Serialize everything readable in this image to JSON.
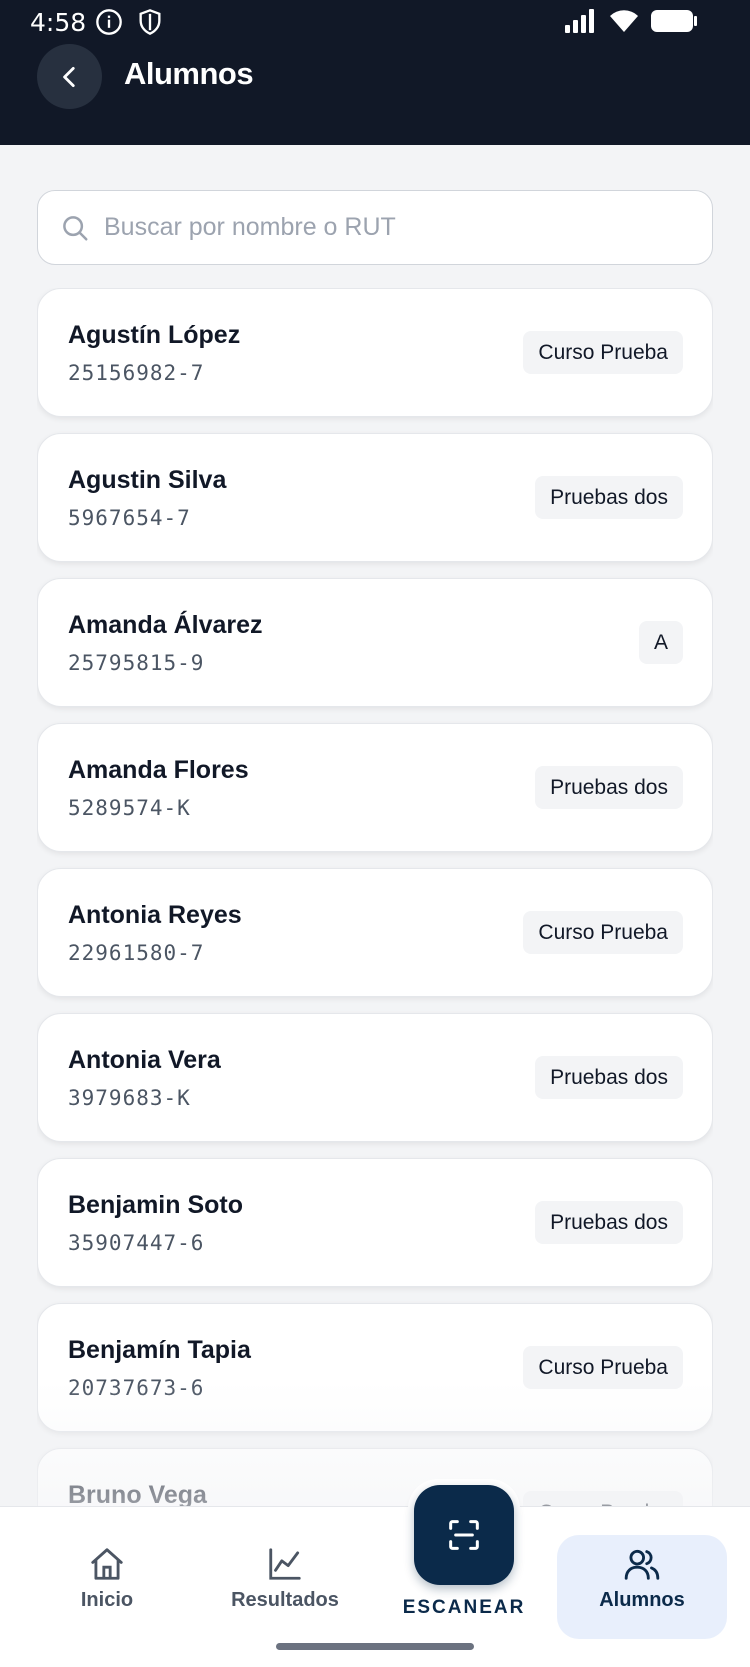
{
  "status_bar": {
    "time": "4:58"
  },
  "header": {
    "title": "Alumnos"
  },
  "search": {
    "placeholder": "Buscar por nombre o RUT",
    "value": ""
  },
  "students": [
    {
      "name": "Agustín López",
      "rut": "25156982-7",
      "course": "Curso Prueba"
    },
    {
      "name": "Agustin Silva",
      "rut": "5967654-7",
      "course": "Pruebas dos"
    },
    {
      "name": "Amanda Álvarez",
      "rut": "25795815-9",
      "course": "A"
    },
    {
      "name": "Amanda Flores",
      "rut": "5289574-K",
      "course": "Pruebas dos"
    },
    {
      "name": "Antonia Reyes",
      "rut": "22961580-7",
      "course": "Curso Prueba"
    },
    {
      "name": "Antonia Vera",
      "rut": "3979683-K",
      "course": "Pruebas dos"
    },
    {
      "name": "Benjamin Soto",
      "rut": "35907447-6",
      "course": "Pruebas dos"
    },
    {
      "name": "Benjamín Tapia",
      "rut": "20737673-6",
      "course": "Curso Prueba"
    },
    {
      "name": "Bruno Vega",
      "rut": "",
      "course": "Curso Prueba"
    }
  ],
  "bottom_nav": {
    "inicio": "Inicio",
    "resultados": "Resultados",
    "escanear": "ESCANEAR",
    "alumnos": "Alumnos",
    "active": "alumnos"
  },
  "colors": {
    "header_bg": "#111827",
    "accent": "#0b2a4a",
    "active_tab_bg": "#e8effc"
  }
}
